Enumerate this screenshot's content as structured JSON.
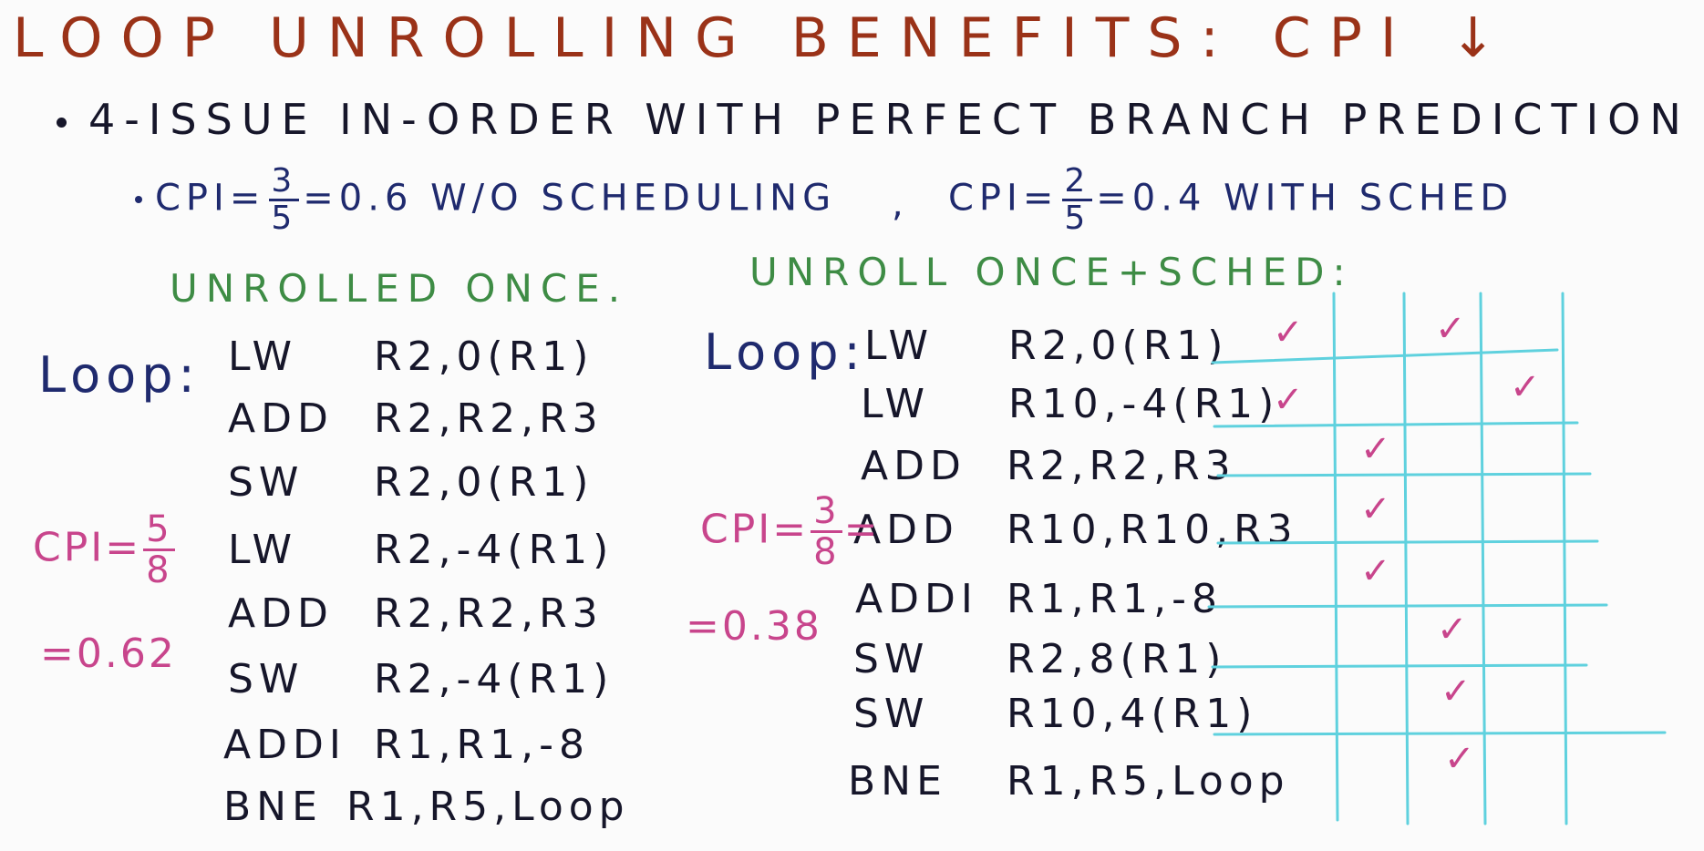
{
  "colors": {
    "title": "#9a3218",
    "text": "#16162a",
    "blue": "#1f2a6e",
    "green": "#3e8c45",
    "pink": "#c8458c",
    "grid": "#5fd1de",
    "check": "#c8458c"
  },
  "title": "LOOP UNROLLING BENEFITS: CPI ↓",
  "bullet": "4-ISSUE IN-ORDER WITH PERFECT BRANCH PREDICTION",
  "sub": {
    "cpi_label_1": "CPI=",
    "frac1_num": "3",
    "frac1_den": "5",
    "rest1": "=0.6 W/O SCHEDULING",
    "comma": ",",
    "cpi_label_2": "CPI=",
    "frac2_num": "2",
    "frac2_den": "5",
    "rest2": "=0.4 WITH SCHED"
  },
  "left": {
    "heading": "UNROLLED ONCE.",
    "loop_label": "Loop:",
    "instructions": [
      {
        "op": "LW",
        "args": "R2,0(R1)"
      },
      {
        "op": "ADD",
        "args": "R2,R2,R3"
      },
      {
        "op": "SW",
        "args": "R2,0(R1)"
      },
      {
        "op": "LW",
        "args": "R2,-4(R1)"
      },
      {
        "op": "ADD",
        "args": "R2,R2,R3"
      },
      {
        "op": "SW",
        "args": "R2,-4(R1)"
      },
      {
        "op": "ADDI",
        "args": "R1,R1,-8"
      },
      {
        "op": "BNE",
        "args": "R1,R5,Loop"
      }
    ],
    "cpi_label": "CPI=",
    "cpi_num": "5",
    "cpi_den": "8",
    "cpi_value": "=0.62"
  },
  "right": {
    "heading": "UNROLL ONCE+SCHED:",
    "loop_label": "Loop:",
    "instructions": [
      {
        "op": "LW",
        "args": "R2,0(R1)"
      },
      {
        "op": "LW",
        "args": "R10,-4(R1)"
      },
      {
        "op": "ADD",
        "args": "R2,R2,R3"
      },
      {
        "op": "ADD",
        "args": "R10,R10,R3"
      },
      {
        "op": "ADDI",
        "args": "R1,R1,-8"
      },
      {
        "op": "SW",
        "args": "R2,8(R1)"
      },
      {
        "op": "SW",
        "args": "R10,4(R1)"
      },
      {
        "op": "BNE",
        "args": "R1,R5,Loop"
      }
    ],
    "cpi_label": "CPI=",
    "cpi_num": "3",
    "cpi_den": "8",
    "cpi_eq": "=",
    "cpi_value": "=0.38",
    "check_mark": "✓"
  }
}
